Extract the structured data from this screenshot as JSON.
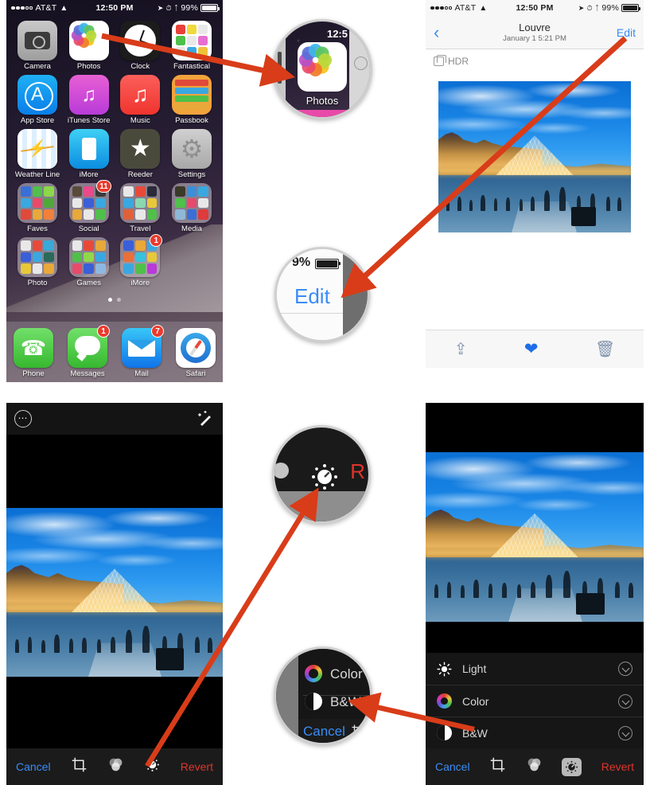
{
  "home_screen": {
    "status_bar": {
      "carrier": "AT&T",
      "signal_dots_filled": 3,
      "signal_dots_empty": 2,
      "wifi_icon": "wifi-icon",
      "time": "12:50 PM",
      "location_icon": "location-arrow-icon",
      "alarm_icon": "alarm-clock-icon",
      "bluetooth_icon": "bluetooth-icon",
      "battery_percent": "99%",
      "battery_icon": "battery-full-icon"
    },
    "rows": [
      [
        {
          "label": "Camera",
          "icon": "camera-icon"
        },
        {
          "label": "Photos",
          "icon": "photos-flower-icon"
        },
        {
          "label": "Clock",
          "icon": "clock-icon"
        },
        {
          "label": "Fantastical",
          "icon": "calendar-icon"
        }
      ],
      [
        {
          "label": "App Store",
          "icon": "app-store-icon"
        },
        {
          "label": "iTunes Store",
          "icon": "itunes-store-icon"
        },
        {
          "label": "Music",
          "icon": "music-note-icon"
        },
        {
          "label": "Passbook",
          "icon": "passbook-icon"
        }
      ],
      [
        {
          "label": "Weather Line",
          "icon": "weather-line-icon"
        },
        {
          "label": "iMore",
          "icon": "imore-icon"
        },
        {
          "label": "Reeder",
          "icon": "star-icon"
        },
        {
          "label": "Settings",
          "icon": "gear-icon"
        }
      ],
      [
        {
          "label": "Faves",
          "icon": "folder-icon",
          "badge": ""
        },
        {
          "label": "Social",
          "icon": "folder-icon",
          "badge": "11"
        },
        {
          "label": "Travel",
          "icon": "folder-icon",
          "badge": ""
        },
        {
          "label": "Media",
          "icon": "folder-icon",
          "badge": ""
        }
      ],
      [
        {
          "label": "Photo",
          "icon": "folder-icon",
          "badge": ""
        },
        {
          "label": "Games",
          "icon": "folder-icon",
          "badge": ""
        },
        {
          "label": "iMore",
          "icon": "folder-icon",
          "badge": "1"
        },
        {
          "label": "",
          "icon": "",
          "badge": ""
        }
      ]
    ],
    "page_dots": {
      "total": 2,
      "active": 1
    },
    "dock": [
      {
        "label": "Phone",
        "icon": "phone-icon",
        "badge": ""
      },
      {
        "label": "Messages",
        "icon": "message-bubble-icon",
        "badge": "1"
      },
      {
        "label": "Mail",
        "icon": "envelope-icon",
        "badge": "7"
      },
      {
        "label": "Safari",
        "icon": "compass-icon",
        "badge": ""
      }
    ]
  },
  "photo_viewer": {
    "status_bar": {
      "carrier": "AT&T",
      "time": "12:50 PM",
      "battery_percent": "99%"
    },
    "nav": {
      "back_icon": "chevron-left-icon",
      "title": "Louvre",
      "subtitle": "January 1  5:21 PM",
      "edit_label": "Edit"
    },
    "hdr_label": "HDR",
    "toolbar": {
      "share_icon": "share-icon",
      "favorite_icon": "heart-icon",
      "favorite_color": "#1d6ee8",
      "trash_icon": "trash-icon"
    }
  },
  "photo_editor": {
    "top": {
      "more_icon": "more-options-icon",
      "auto_enhance_icon": "magic-wand-icon"
    },
    "toolbar": {
      "cancel_label": "Cancel",
      "cancel_color": "#3b8cf5",
      "crop_icon": "crop-icon",
      "filters_icon": "filters-icon",
      "adjust_icon": "adjust-dial-icon",
      "revert_label": "Revert",
      "revert_color": "#e0342b"
    }
  },
  "photo_editor_adjust": {
    "rows": [
      {
        "label": "Light",
        "icon": "sun-icon",
        "chevron": "chevron-down-icon"
      },
      {
        "label": "Color",
        "icon": "color-wheel-icon",
        "chevron": "chevron-down-icon"
      },
      {
        "label": "B&W",
        "icon": "black-white-icon",
        "chevron": "chevron-down-icon"
      }
    ],
    "toolbar": {
      "cancel_label": "Cancel",
      "crop_icon": "crop-icon",
      "filters_icon": "filters-icon",
      "adjust_icon": "adjust-dial-icon",
      "adjust_selected": true,
      "revert_label": "Revert"
    }
  },
  "magnifiers": [
    {
      "name": "photos-app-callout",
      "content_label": "Photos",
      "content_time": "12:5",
      "icon": "photos-flower-icon"
    },
    {
      "name": "edit-button-callout",
      "content_label": "Edit",
      "battery_text": "9%",
      "label_color": "#3b8cf5"
    },
    {
      "name": "adjust-tool-callout",
      "content_label": "R",
      "icon": "adjust-dial-icon",
      "label_color": "#e0342b"
    },
    {
      "name": "bw-option-callout",
      "rows": [
        "Color",
        "B&W"
      ],
      "cancel_label": "Cancel",
      "cancel_color": "#3b8cf5"
    }
  ],
  "annotations": {
    "arrow_color": "#d93c19",
    "arrow_count": 4
  }
}
